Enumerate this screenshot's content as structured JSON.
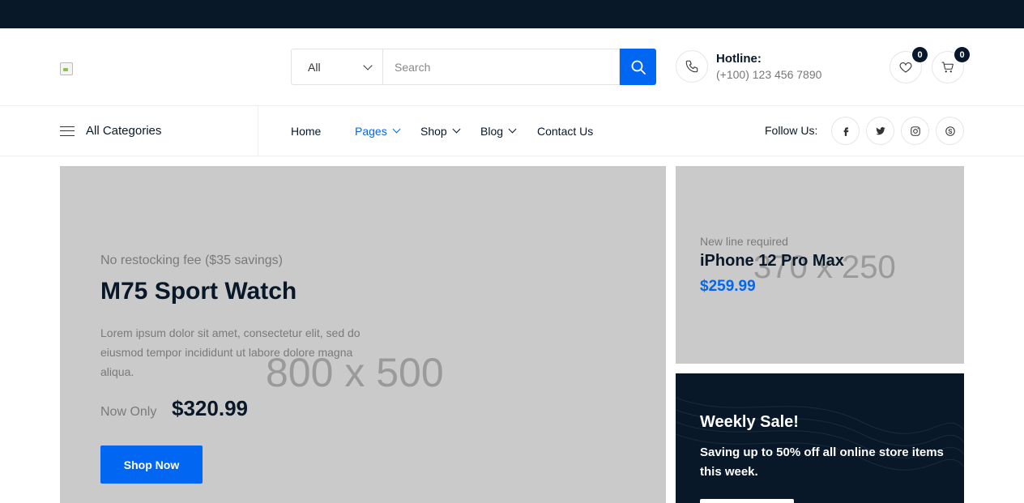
{
  "search": {
    "category": "All",
    "placeholder": "Search"
  },
  "hotline": {
    "label": "Hotline:",
    "number": "(+100) 123 456 7890"
  },
  "wishlist": {
    "count": "0"
  },
  "cart": {
    "count": "0"
  },
  "nav": {
    "all_categories": "All Categories",
    "items": [
      {
        "label": "Home"
      },
      {
        "label": "Pages"
      },
      {
        "label": "Shop"
      },
      {
        "label": "Blog"
      },
      {
        "label": "Contact Us"
      }
    ],
    "follow": "Follow Us:"
  },
  "hero": {
    "placeholder": "800 x 500",
    "subtitle": "No restocking fee ($35 savings)",
    "title": "M75 Sport Watch",
    "description": "Lorem ipsum dolor sit amet, consectetur elit, sed do eiusmod tempor incididunt ut labore dolore magna aliqua.",
    "now_only": "Now Only",
    "price": "$320.99",
    "button": "Shop Now"
  },
  "side_banner": {
    "placeholder": "370 x 250",
    "subtitle": "New line required",
    "title": "iPhone 12 Pro Max",
    "price": "$259.99"
  },
  "weekly": {
    "title": "Weekly Sale!",
    "text": "Saving up to 50% off all online store items this week."
  },
  "colors": {
    "accent": "#0167f3",
    "dark": "#081828",
    "placeholder_bg": "#cacaca"
  }
}
